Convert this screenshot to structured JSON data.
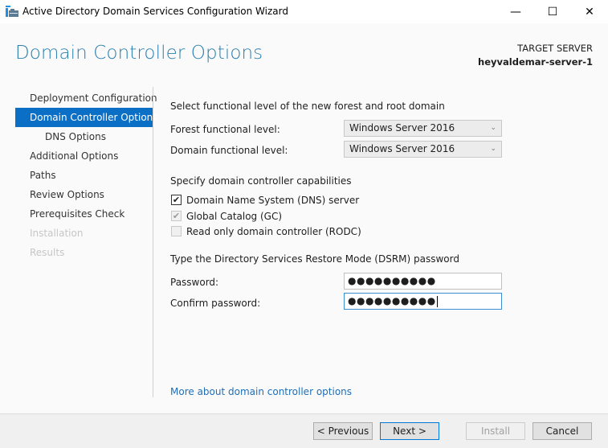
{
  "window": {
    "title": "Active Directory Domain Services Configuration Wizard",
    "minimize_glyph": "—",
    "maximize_glyph": "☐",
    "close_glyph": "✕"
  },
  "header": {
    "page_title": "Domain Controller Options",
    "target_label": "TARGET SERVER",
    "target_name": "heyvaldemar-server-1"
  },
  "nav": {
    "items": [
      {
        "label": "Deployment Configuration",
        "state": "normal"
      },
      {
        "label": "Domain Controller Options",
        "state": "active"
      },
      {
        "label": "DNS Options",
        "state": "sub"
      },
      {
        "label": "Additional Options",
        "state": "normal"
      },
      {
        "label": "Paths",
        "state": "normal"
      },
      {
        "label": "Review Options",
        "state": "normal"
      },
      {
        "label": "Prerequisites Check",
        "state": "normal"
      },
      {
        "label": "Installation",
        "state": "disabled"
      },
      {
        "label": "Results",
        "state": "disabled"
      }
    ]
  },
  "functional": {
    "heading": "Select functional level of the new forest and root domain",
    "forest_label": "Forest functional level:",
    "forest_value": "Windows Server 2016",
    "domain_label": "Domain functional level:",
    "domain_value": "Windows Server 2016",
    "chevron": "⌄"
  },
  "capabilities": {
    "heading": "Specify domain controller capabilities",
    "items": [
      {
        "label": "Domain Name System (DNS) server",
        "checked": true,
        "enabled": true,
        "mark": "✔"
      },
      {
        "label": "Global Catalog (GC)",
        "checked": true,
        "enabled": false,
        "mark": "✔"
      },
      {
        "label": "Read only domain controller (RODC)",
        "checked": false,
        "enabled": false,
        "mark": ""
      }
    ]
  },
  "dsrm": {
    "heading": "Type the Directory Services Restore Mode (DSRM) password",
    "password_label": "Password:",
    "password_value": "●●●●●●●●●●",
    "confirm_label": "Confirm password:",
    "confirm_value": "●●●●●●●●●●"
  },
  "link": {
    "label": "More about domain controller options"
  },
  "buttons": {
    "previous": "< Previous",
    "next": "Next >",
    "install": "Install",
    "cancel": "Cancel"
  },
  "colors": {
    "accent": "#0b6fc6",
    "title": "#2a7fae",
    "link": "#1f6eb8"
  }
}
